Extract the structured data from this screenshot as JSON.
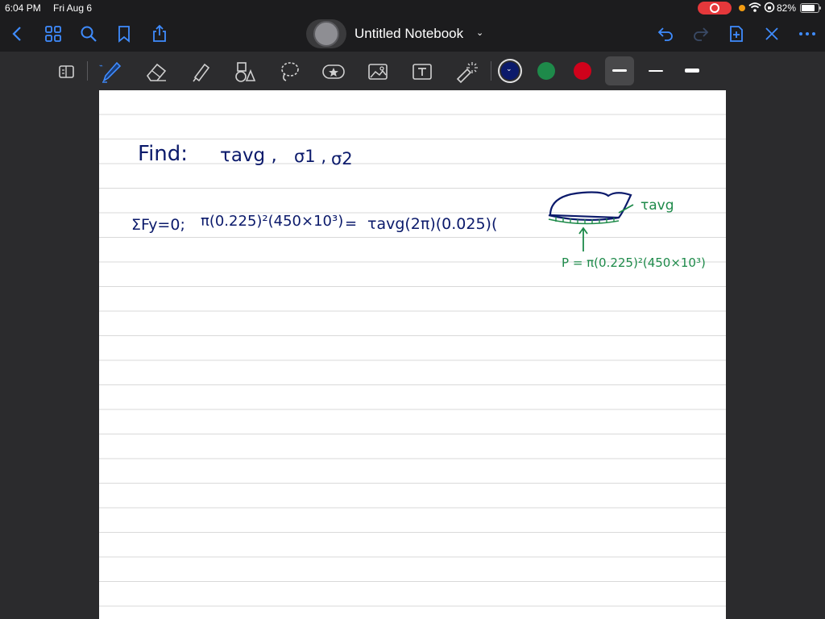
{
  "status_bar": {
    "time": "6:04 PM",
    "date": "Fri Aug 6",
    "battery_percent": "82%",
    "battery_level": 0.82
  },
  "nav_bar": {
    "notebook_title": "Untitled Notebook",
    "title_chevron": "⌄"
  },
  "toolbar": {
    "tools": [
      "page-layout-icon",
      "pen-icon",
      "eraser-icon",
      "highlighter-icon",
      "shapes-icon",
      "lasso-icon",
      "sticker-icon",
      "image-icon",
      "text-icon",
      "laser-pointer-icon"
    ],
    "colors": [
      "#0b1a6b",
      "#1e8a4a",
      "#d0021b"
    ],
    "selected_color": "#0b1a6b"
  },
  "notes": {
    "line1": {
      "find": "Find:",
      "tau_avg": "τavg ,",
      "sigma1": "σ1 ,",
      "sigma2": "σ2"
    },
    "line2": {
      "sum": "ΣFy=0;",
      "lhs": "π(0.225)²(450×10³)",
      "eq": "=",
      "rhs": "τavg(2π)(0.025)("
    },
    "diagram": {
      "tau_label": "τavg",
      "p_label": "P = π(0.225)²(450×10³)"
    }
  }
}
